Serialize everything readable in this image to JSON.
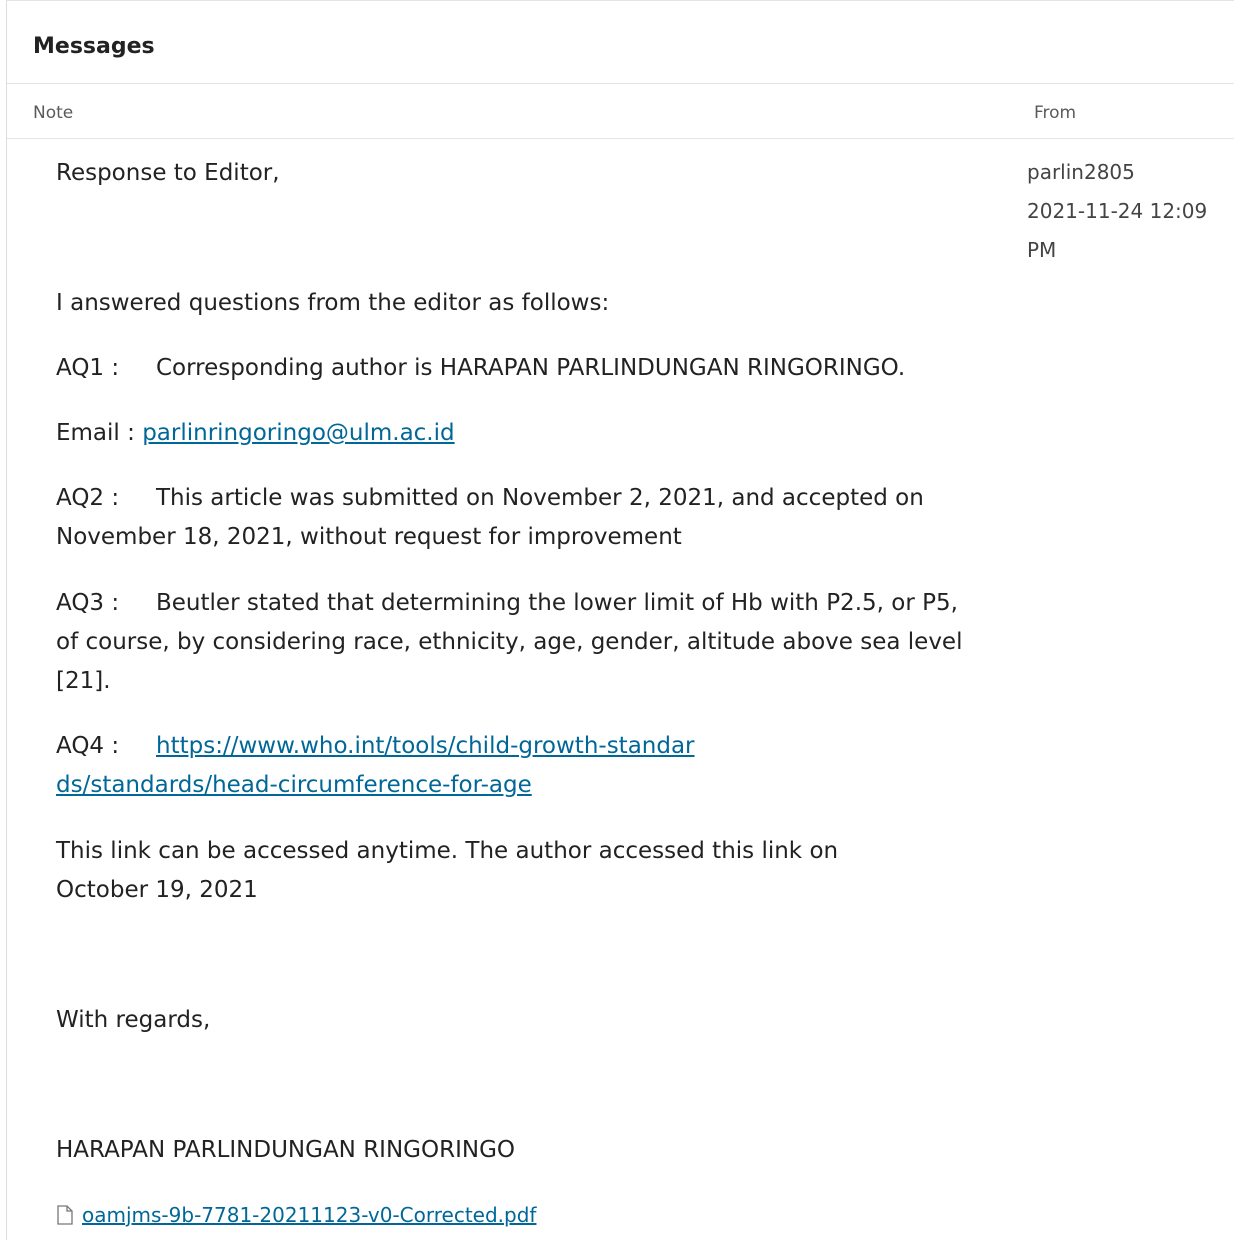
{
  "header": {
    "title": "Messages"
  },
  "columns": {
    "note": "Note",
    "from": "From"
  },
  "message": {
    "greeting": "Response to Editor,",
    "intro": "I answered questions from the editor as follows:",
    "aq1_label": "AQ1 :",
    "aq1_text": "Corresponding author is HARAPAN PARLINDUNGAN RINGORINGO.",
    "email_label": "Email :",
    "email": "parlinringoringo@ulm.ac.id",
    "aq2_label": "AQ2 :",
    "aq2_text": "This article was submitted on November 2, 2021, and accepted on November 18, 2021, without request for improvement",
    "aq3_label": "AQ3 :",
    "aq3_text": "Beutler stated that determining the lower limit of Hb with P2.5, or P5, of course, by considering race, ethnicity, age, gender, altitude above sea level [21].",
    "aq4_label": "AQ4 :",
    "aq4_link": "https://www.who.int/tools/child-growth-standards/standards/head-circumference-for-age",
    "access_note": "This link can be accessed anytime. The author accessed this link on October 19, 2021",
    "regards": "With regards,",
    "signature": "HARAPAN PARLINDUNGAN RINGORINGO",
    "attachment": "oamjms-9b-7781-20211123-v0-Corrected.pdf",
    "attachment_icon": "file-icon"
  },
  "sender": {
    "username": "parlin2805",
    "datetime": "2021-11-24 12:09 PM"
  },
  "colors": {
    "link": "#006798",
    "text": "#222222",
    "muted": "#5a5a5a"
  }
}
